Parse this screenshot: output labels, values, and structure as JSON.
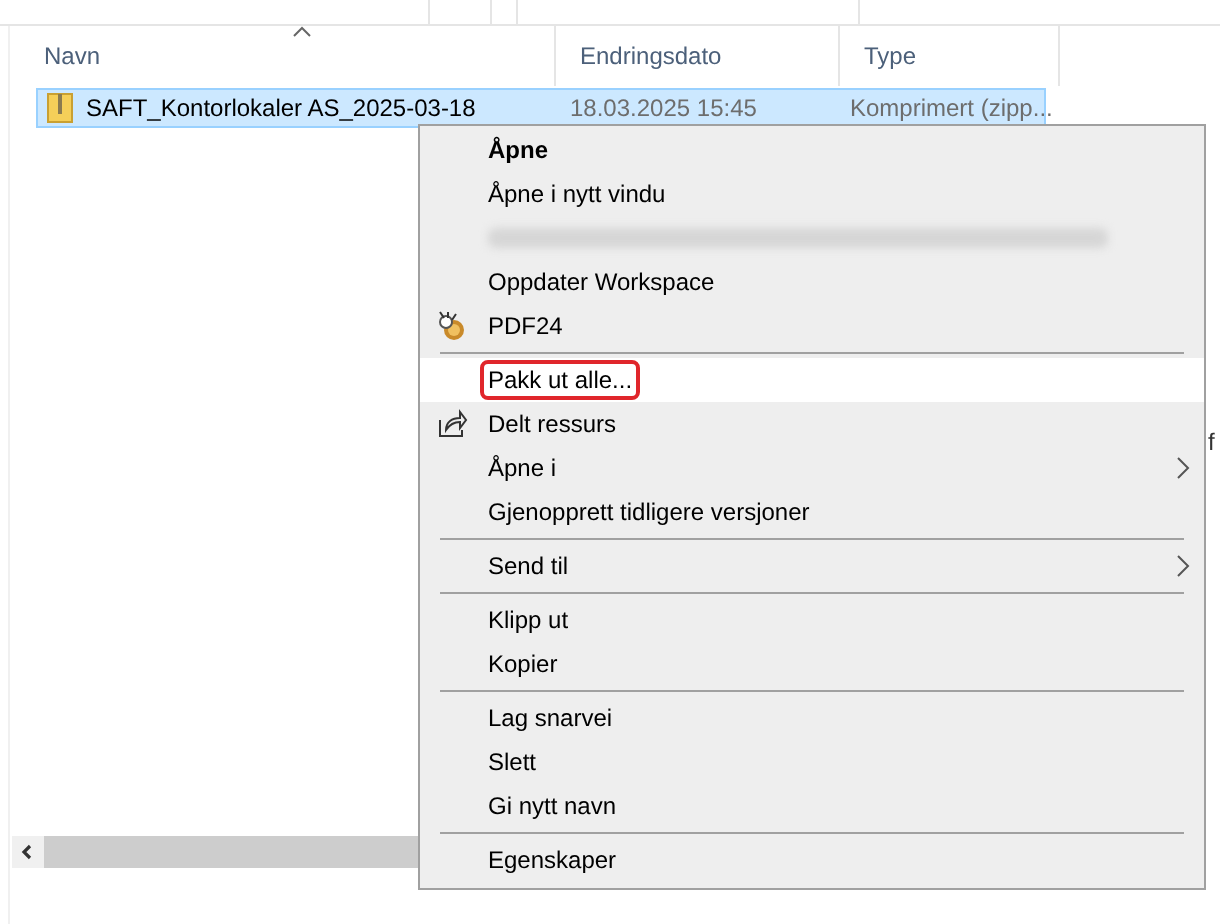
{
  "file_list": {
    "columns": [
      {
        "label": "Navn",
        "sorted": true
      },
      {
        "label": "Endringsdato",
        "sorted": false
      },
      {
        "label": "Type",
        "sorted": false
      }
    ],
    "rows": [
      {
        "selected": true,
        "cells": [
          "SAFT_Kontorlokaler AS_2025-03-18",
          "18.03.2025 15:45",
          "Komprimert (zipp..."
        ]
      }
    ],
    "background_text": "f"
  },
  "context_menu": {
    "items": [
      {
        "kind": "item",
        "label": "Åpne",
        "default": true
      },
      {
        "kind": "item",
        "label": "Åpne i nytt vindu"
      },
      {
        "kind": "redacted"
      },
      {
        "kind": "item",
        "label": "Oppdater Workspace"
      },
      {
        "kind": "item",
        "label": "PDF24"
      },
      {
        "kind": "separator"
      },
      {
        "kind": "item",
        "label": "Pakk ut alle...",
        "highlighted": true,
        "annotated": true
      },
      {
        "kind": "item",
        "label": "Delt ressurs"
      },
      {
        "kind": "item",
        "label": "Åpne i",
        "submenu": true
      },
      {
        "kind": "item",
        "label": "Gjenopprett tidligere versjoner"
      },
      {
        "kind": "separator"
      },
      {
        "kind": "item",
        "label": "Send til",
        "submenu": true
      },
      {
        "kind": "separator"
      },
      {
        "kind": "item",
        "label": "Klipp ut"
      },
      {
        "kind": "item",
        "label": "Kopier"
      },
      {
        "kind": "separator"
      },
      {
        "kind": "item",
        "label": "Lag snarvei"
      },
      {
        "kind": "item",
        "label": "Slett"
      },
      {
        "kind": "item",
        "label": "Gi nytt navn"
      },
      {
        "kind": "separator"
      },
      {
        "kind": "item",
        "label": "Egenskaper"
      }
    ]
  }
}
